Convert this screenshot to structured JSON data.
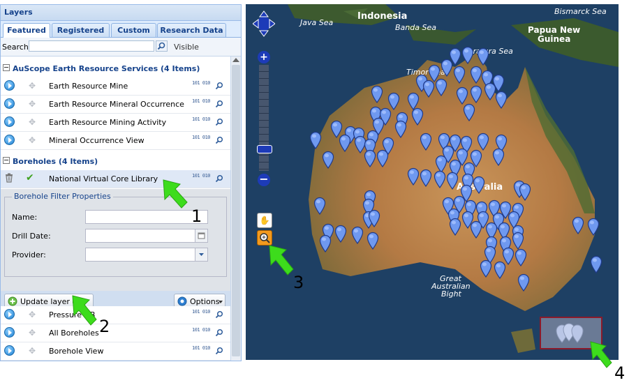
{
  "top_caption": "",
  "panel": {
    "title": "Layers",
    "tabs": [
      {
        "label": "Featured",
        "active": true
      },
      {
        "label": "Registered",
        "active": false
      },
      {
        "label": "Custom",
        "active": false
      },
      {
        "label": "Research Data",
        "active": false
      }
    ],
    "search_label": "Search:",
    "search_value": "",
    "visible_label": "Visible"
  },
  "groups": [
    {
      "title": "AuScope Earth Resource Services (4 Items)",
      "items": [
        "Earth Resource Mine",
        "Earth Resource Mineral Occurrence",
        "Earth Resource Mining Activity",
        "Mineral Occurrence View"
      ]
    },
    {
      "title": "Boreholes (4 Items)",
      "selected_item": "National Virtual Core Library",
      "items": [
        "Pressure DB",
        "All Boreholes",
        "Borehole View"
      ]
    }
  ],
  "row_icon_text": "101 010",
  "filter": {
    "legend": "Borehole Filter Properties",
    "fields": [
      {
        "label": "Name:",
        "value": ""
      },
      {
        "label": "Drill Date:",
        "value": ""
      },
      {
        "label": "Provider:",
        "value": ""
      }
    ]
  },
  "toolbar": {
    "update_label": "Update layer on Map",
    "options_label": "Options"
  },
  "map": {
    "labels": [
      {
        "text": "Indonesia"
      },
      {
        "text": "Java Sea"
      },
      {
        "text": "Banda Sea"
      },
      {
        "text": "Bismarck Sea"
      },
      {
        "text": "Papua New"
      },
      {
        "text": "Guinea"
      },
      {
        "text": "Arafura Sea"
      },
      {
        "text": "Timor Sea"
      },
      {
        "text": "Australia"
      },
      {
        "text": "Great"
      },
      {
        "text": "Australian"
      },
      {
        "text": "Bight"
      }
    ]
  },
  "annotations": [
    "1",
    "2",
    "3",
    "4"
  ],
  "colors": {
    "arrow": "#3ddc1c",
    "pin": "#6f99f0",
    "panel_border": "#99bbe8",
    "header_text": "#15428b"
  }
}
